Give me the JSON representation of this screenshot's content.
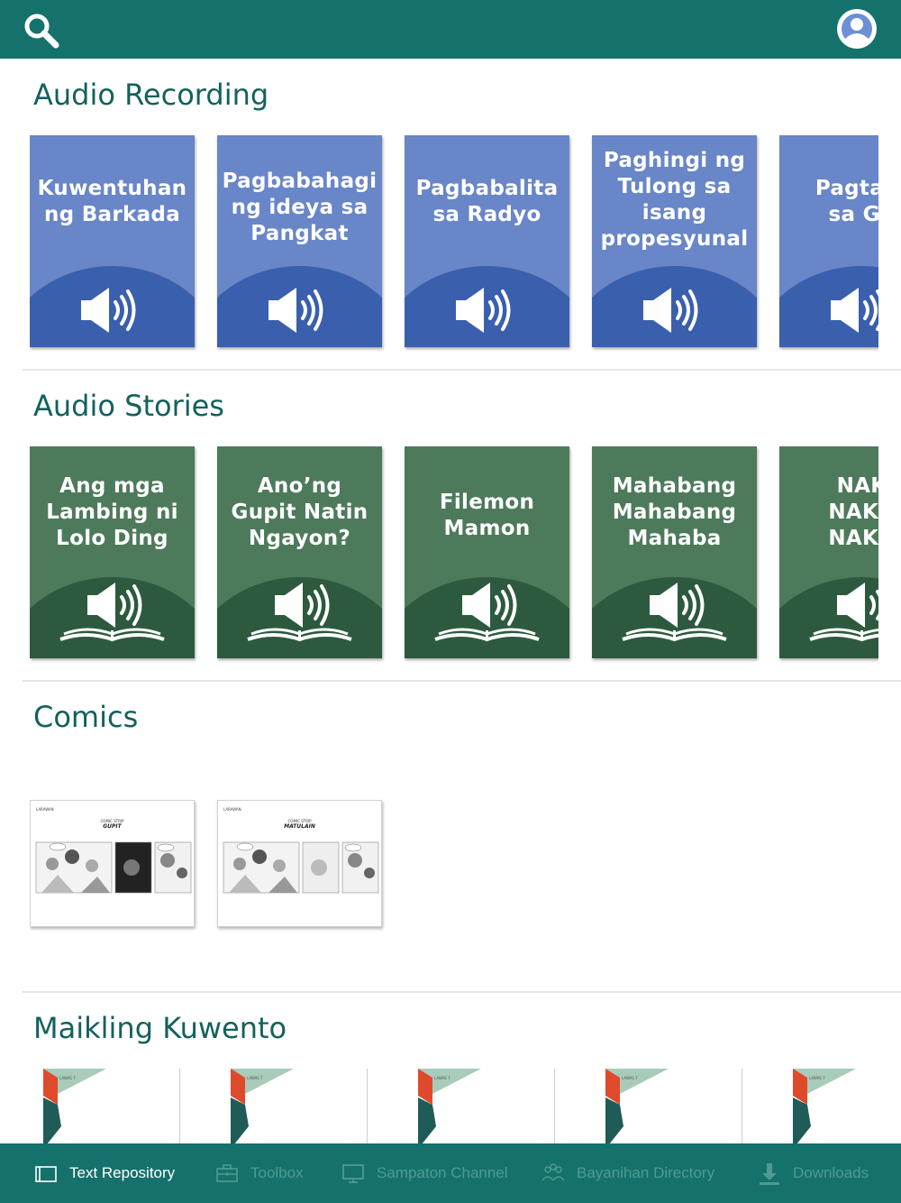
{
  "header": {
    "search_icon": "search-icon",
    "avatar_icon": "user-avatar-icon"
  },
  "sections": {
    "audio_recording": {
      "title": "Audio Recording",
      "color": "#6886c8",
      "items": [
        {
          "title": "Kuwentuhan\nng Barkada"
        },
        {
          "title": "Pagbabahagi\nng ideya sa\nPangkat"
        },
        {
          "title": "Pagbabalita\nsa Radyo"
        },
        {
          "title": "Paghingi ng\nTulong sa\nisang\npropesyunal"
        },
        {
          "title": "Pagtata\nsa Gu"
        }
      ]
    },
    "audio_stories": {
      "title": "Audio Stories",
      "color": "#4d7a5b",
      "items": [
        {
          "title": "Ang mga\nLambing ni\nLolo Ding"
        },
        {
          "title": "Ano’ng\nGupit Natin\nNgayon?"
        },
        {
          "title": "Filemon\nMamon"
        },
        {
          "title": "Mahabang\nMahabang\nMahaba"
        },
        {
          "title": "NAK\nNAKU\nNAKU"
        }
      ]
    },
    "comics": {
      "title": "Comics",
      "items": [
        {
          "label": "LARAWAN",
          "heading": "COMIC STRIP",
          "subtitle": "GUPIT"
        },
        {
          "label": "LARAWAN",
          "heading": "COMIC STRIP",
          "subtitle": "MATULAIN"
        }
      ]
    },
    "maikling_kuwento": {
      "title": "Maikling Kuwento",
      "items": [
        {
          "label": "LAWAS 7"
        },
        {
          "label": "LAWAS 7"
        },
        {
          "label": "LAWAS 7"
        },
        {
          "label": "LAWAS 7"
        },
        {
          "label": "LAWAS 7"
        }
      ]
    }
  },
  "bottom_nav": {
    "tabs": [
      {
        "label": "Text Repository",
        "icon": "folder-icon",
        "active": true
      },
      {
        "label": "Toolbox",
        "icon": "toolbox-icon",
        "active": false
      },
      {
        "label": "Sampaton Channel",
        "icon": "monitor-icon",
        "active": false
      },
      {
        "label": "Bayanihan Directory",
        "icon": "people-icon",
        "active": false
      },
      {
        "label": "Downloads",
        "icon": "download-icon",
        "active": false
      }
    ]
  },
  "colors": {
    "brand": "#15716b",
    "section_title": "#14615c",
    "recording_card": "#6886c8",
    "recording_arc": "#3a5fad",
    "story_card": "#4d7a5b",
    "story_arc": "#2d5a3e",
    "inactive_tab": "#4f9a93"
  }
}
